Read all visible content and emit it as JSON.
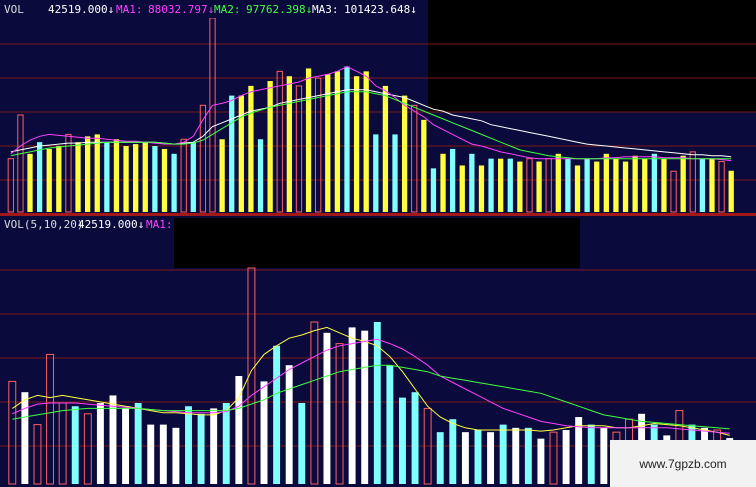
{
  "top_header": {
    "vol_label": "VOL",
    "vol_value": "42519.000↓",
    "ma1_label": "MA1:",
    "ma1_value": "88032.797↓",
    "ma2_label": "MA2:",
    "ma2_value": "97762.398↓",
    "ma3_label": "MA3:",
    "ma3_value": "101423.648↓"
  },
  "bottom_header": {
    "label": "VOL(5,10,20)",
    "value": "42519.000↓",
    "ma1_label": "MA1:"
  },
  "watermark": "www.7gpzb.com",
  "colors": {
    "panel_bg": "#0a0a3c",
    "grid": "#7a1a1a",
    "ma1": "#ffffff",
    "ma2": "#ff40ff",
    "ma3": "#40ff40",
    "ma5_bottom": "#ffff40",
    "ma10_bottom": "#ff40ff",
    "ma20_bottom": "#40ff40",
    "bar_yellow": "#ffff40",
    "bar_cyan": "#80ffff",
    "bar_hollow": "#ff6060",
    "bar_white": "#ffffff"
  },
  "chart_data": [
    {
      "type": "bar",
      "panel": "top",
      "ylim": [
        0,
        200000
      ],
      "bars": [
        {
          "v": 55000,
          "s": "hollow"
        },
        {
          "v": 100000,
          "s": "hollow"
        },
        {
          "v": 60000,
          "s": "yellow"
        },
        {
          "v": 72000,
          "s": "cyan"
        },
        {
          "v": 65000,
          "s": "yellow"
        },
        {
          "v": 68000,
          "s": "yellow"
        },
        {
          "v": 80000,
          "s": "hollow"
        },
        {
          "v": 72000,
          "s": "yellow"
        },
        {
          "v": 78000,
          "s": "yellow"
        },
        {
          "v": 80000,
          "s": "yellow"
        },
        {
          "v": 72000,
          "s": "cyan"
        },
        {
          "v": 75000,
          "s": "yellow"
        },
        {
          "v": 68000,
          "s": "yellow"
        },
        {
          "v": 70000,
          "s": "yellow"
        },
        {
          "v": 72000,
          "s": "yellow"
        },
        {
          "v": 68000,
          "s": "cyan"
        },
        {
          "v": 65000,
          "s": "yellow"
        },
        {
          "v": 60000,
          "s": "cyan"
        },
        {
          "v": 75000,
          "s": "hollow"
        },
        {
          "v": 72000,
          "s": "cyan"
        },
        {
          "v": 110000,
          "s": "hollow"
        },
        {
          "v": 200000,
          "s": "hollow"
        },
        {
          "v": 75000,
          "s": "yellow"
        },
        {
          "v": 120000,
          "s": "cyan"
        },
        {
          "v": 120000,
          "s": "yellow"
        },
        {
          "v": 130000,
          "s": "yellow"
        },
        {
          "v": 75000,
          "s": "cyan"
        },
        {
          "v": 135000,
          "s": "yellow"
        },
        {
          "v": 145000,
          "s": "hollow"
        },
        {
          "v": 140000,
          "s": "yellow"
        },
        {
          "v": 130000,
          "s": "hollow"
        },
        {
          "v": 148000,
          "s": "yellow"
        },
        {
          "v": 138000,
          "s": "hollow"
        },
        {
          "v": 142000,
          "s": "yellow"
        },
        {
          "v": 145000,
          "s": "yellow"
        },
        {
          "v": 150000,
          "s": "cyan"
        },
        {
          "v": 140000,
          "s": "yellow"
        },
        {
          "v": 145000,
          "s": "yellow"
        },
        {
          "v": 80000,
          "s": "cyan"
        },
        {
          "v": 130000,
          "s": "yellow"
        },
        {
          "v": 80000,
          "s": "cyan"
        },
        {
          "v": 120000,
          "s": "yellow"
        },
        {
          "v": 110000,
          "s": "hollow"
        },
        {
          "v": 95000,
          "s": "yellow"
        },
        {
          "v": 45000,
          "s": "cyan"
        },
        {
          "v": 60000,
          "s": "yellow"
        },
        {
          "v": 65000,
          "s": "cyan"
        },
        {
          "v": 48000,
          "s": "yellow"
        },
        {
          "v": 60000,
          "s": "cyan"
        },
        {
          "v": 48000,
          "s": "yellow"
        },
        {
          "v": 55000,
          "s": "cyan"
        },
        {
          "v": 55000,
          "s": "yellow"
        },
        {
          "v": 55000,
          "s": "cyan"
        },
        {
          "v": 52000,
          "s": "yellow"
        },
        {
          "v": 55000,
          "s": "hollow"
        },
        {
          "v": 52000,
          "s": "yellow"
        },
        {
          "v": 55000,
          "s": "hollow"
        },
        {
          "v": 60000,
          "s": "yellow"
        },
        {
          "v": 55000,
          "s": "cyan"
        },
        {
          "v": 48000,
          "s": "yellow"
        },
        {
          "v": 55000,
          "s": "cyan"
        },
        {
          "v": 52000,
          "s": "yellow"
        },
        {
          "v": 60000,
          "s": "yellow"
        },
        {
          "v": 55000,
          "s": "yellow"
        },
        {
          "v": 52000,
          "s": "yellow"
        },
        {
          "v": 58000,
          "s": "yellow"
        },
        {
          "v": 55000,
          "s": "yellow"
        },
        {
          "v": 60000,
          "s": "cyan"
        },
        {
          "v": 55000,
          "s": "yellow"
        },
        {
          "v": 42000,
          "s": "hollow"
        },
        {
          "v": 58000,
          "s": "yellow"
        },
        {
          "v": 62000,
          "s": "hollow"
        },
        {
          "v": 55000,
          "s": "cyan"
        },
        {
          "v": 55000,
          "s": "yellow"
        },
        {
          "v": 52000,
          "s": "hollow"
        },
        {
          "v": 42519,
          "s": "yellow"
        }
      ],
      "series": [
        {
          "key": "ma1",
          "color": "#ffffff",
          "values": [
            62000,
            64000,
            66000,
            68000,
            69000,
            70000,
            71000,
            71000,
            72000,
            72000,
            72000,
            72000,
            72000,
            72000,
            72000,
            72000,
            71000,
            70000,
            71000,
            72000,
            78000,
            88000,
            92000,
            96000,
            100000,
            104000,
            106000,
            108000,
            112000,
            114000,
            116000,
            118000,
            120000,
            122000,
            124000,
            126000,
            126000,
            126000,
            124000,
            122000,
            120000,
            118000,
            114000,
            110000,
            106000,
            104000,
            100000,
            98000,
            96000,
            94000,
            90000,
            88000,
            86000,
            84000,
            82000,
            80000,
            78000,
            76000,
            74000,
            72000,
            70000,
            69000,
            68000,
            67000,
            66000,
            65000,
            64000,
            63000,
            62000,
            61000,
            60000,
            59000,
            59000,
            58000,
            58000,
            57000
          ]
        },
        {
          "key": "ma2",
          "color": "#ff40ff",
          "values": [
            60000,
            68000,
            74000,
            78000,
            80000,
            79000,
            78000,
            77000,
            76000,
            76000,
            75000,
            74000,
            73000,
            73000,
            72000,
            71000,
            70000,
            70000,
            72000,
            78000,
            95000,
            110000,
            112000,
            115000,
            120000,
            124000,
            126000,
            128000,
            130000,
            132000,
            134000,
            138000,
            140000,
            142000,
            145000,
            150000,
            145000,
            140000,
            130000,
            125000,
            118000,
            110000,
            104000,
            98000,
            90000,
            85000,
            80000,
            75000,
            70000,
            68000,
            65000,
            62000,
            60000,
            58000,
            56000,
            55000,
            55000,
            55000,
            55000,
            55000,
            55000,
            55000,
            56000,
            56000,
            57000,
            57000,
            57000,
            57000,
            56000,
            56000,
            56000,
            55000,
            55000,
            55000,
            54000,
            53000
          ]
        },
        {
          "key": "ma3",
          "color": "#40ff40",
          "values": [
            58000,
            60000,
            62000,
            64000,
            66000,
            67000,
            68000,
            69000,
            70000,
            71000,
            72000,
            72000,
            72000,
            72000,
            72000,
            72000,
            71000,
            70000,
            70000,
            71000,
            74000,
            80000,
            86000,
            92000,
            98000,
            102000,
            105000,
            108000,
            110000,
            112000,
            114000,
            116000,
            118000,
            120000,
            122000,
            124000,
            124000,
            124000,
            122000,
            120000,
            116000,
            112000,
            108000,
            104000,
            100000,
            96000,
            92000,
            88000,
            84000,
            80000,
            76000,
            72000,
            68000,
            64000,
            62000,
            60000,
            58000,
            57000,
            56000,
            55000,
            55000,
            55000,
            55000,
            55000,
            55000,
            55000,
            55000,
            55000,
            55000,
            55000,
            55000,
            55000,
            55000,
            55000,
            55000,
            55000
          ]
        }
      ]
    },
    {
      "type": "bar",
      "panel": "bottom",
      "ylim": [
        0,
        200000
      ],
      "bars": [
        {
          "v": 95000,
          "s": "hollow"
        },
        {
          "v": 85000,
          "s": "white"
        },
        {
          "v": 55000,
          "s": "hollow"
        },
        {
          "v": 120000,
          "s": "hollow"
        },
        {
          "v": 75000,
          "s": "hollow"
        },
        {
          "v": 72000,
          "s": "cyan"
        },
        {
          "v": 65000,
          "s": "hollow"
        },
        {
          "v": 75000,
          "s": "white"
        },
        {
          "v": 82000,
          "s": "white"
        },
        {
          "v": 70000,
          "s": "white"
        },
        {
          "v": 75000,
          "s": "cyan"
        },
        {
          "v": 55000,
          "s": "white"
        },
        {
          "v": 55000,
          "s": "white"
        },
        {
          "v": 52000,
          "s": "white"
        },
        {
          "v": 72000,
          "s": "cyan"
        },
        {
          "v": 65000,
          "s": "cyan"
        },
        {
          "v": 70000,
          "s": "white"
        },
        {
          "v": 75000,
          "s": "cyan"
        },
        {
          "v": 100000,
          "s": "white"
        },
        {
          "v": 200000,
          "s": "hollow"
        },
        {
          "v": 95000,
          "s": "white"
        },
        {
          "v": 128000,
          "s": "cyan"
        },
        {
          "v": 110000,
          "s": "white"
        },
        {
          "v": 75000,
          "s": "cyan"
        },
        {
          "v": 150000,
          "s": "hollow"
        },
        {
          "v": 140000,
          "s": "white"
        },
        {
          "v": 130000,
          "s": "hollow"
        },
        {
          "v": 145000,
          "s": "white"
        },
        {
          "v": 142000,
          "s": "white"
        },
        {
          "v": 150000,
          "s": "cyan"
        },
        {
          "v": 110000,
          "s": "cyan"
        },
        {
          "v": 80000,
          "s": "cyan"
        },
        {
          "v": 85000,
          "s": "cyan"
        },
        {
          "v": 70000,
          "s": "hollow"
        },
        {
          "v": 48000,
          "s": "cyan"
        },
        {
          "v": 60000,
          "s": "cyan"
        },
        {
          "v": 48000,
          "s": "white"
        },
        {
          "v": 50000,
          "s": "cyan"
        },
        {
          "v": 48000,
          "s": "white"
        },
        {
          "v": 55000,
          "s": "cyan"
        },
        {
          "v": 52000,
          "s": "white"
        },
        {
          "v": 52000,
          "s": "cyan"
        },
        {
          "v": 42000,
          "s": "white"
        },
        {
          "v": 48000,
          "s": "hollow"
        },
        {
          "v": 50000,
          "s": "white"
        },
        {
          "v": 62000,
          "s": "white"
        },
        {
          "v": 55000,
          "s": "cyan"
        },
        {
          "v": 52000,
          "s": "white"
        },
        {
          "v": 48000,
          "s": "hollow"
        },
        {
          "v": 60000,
          "s": "hollow"
        },
        {
          "v": 65000,
          "s": "white"
        },
        {
          "v": 55000,
          "s": "cyan"
        },
        {
          "v": 45000,
          "s": "white"
        },
        {
          "v": 68000,
          "s": "hollow"
        },
        {
          "v": 55000,
          "s": "cyan"
        },
        {
          "v": 52000,
          "s": "white"
        },
        {
          "v": 50000,
          "s": "hollow"
        },
        {
          "v": 42519,
          "s": "white"
        }
      ],
      "series": [
        {
          "key": "ma5",
          "color": "#ffff40",
          "values": [
            70000,
            78000,
            82000,
            80000,
            82000,
            80000,
            78000,
            76000,
            74000,
            72000,
            70000,
            68000,
            66000,
            66000,
            65000,
            64000,
            64000,
            68000,
            80000,
            105000,
            120000,
            128000,
            135000,
            138000,
            142000,
            145000,
            140000,
            135000,
            132000,
            128000,
            118000,
            104000,
            88000,
            72000,
            62000,
            56000,
            52000,
            50000,
            50000,
            50000,
            50000,
            50000,
            49000,
            50000,
            52000,
            54000,
            54000,
            54000,
            52000,
            52000,
            54000,
            56000,
            55000,
            54000,
            52000,
            50000,
            48000,
            45000
          ]
        },
        {
          "key": "ma10",
          "color": "#ff40ff",
          "values": [
            65000,
            70000,
            74000,
            75000,
            75000,
            75000,
            74000,
            73000,
            72000,
            71000,
            70000,
            69000,
            68000,
            67000,
            66000,
            66000,
            66000,
            67000,
            72000,
            82000,
            90000,
            98000,
            106000,
            112000,
            118000,
            124000,
            128000,
            130000,
            132000,
            134000,
            130000,
            125000,
            118000,
            110000,
            100000,
            94000,
            88000,
            82000,
            76000,
            70000,
            66000,
            62000,
            58000,
            56000,
            54000,
            53000,
            52000,
            52000,
            52000,
            52000,
            52000,
            52000,
            52000,
            51000,
            50000,
            49000,
            48000,
            47000
          ]
        },
        {
          "key": "ma20",
          "color": "#40ff40",
          "values": [
            60000,
            62000,
            64000,
            66000,
            68000,
            69000,
            70000,
            70000,
            70000,
            70000,
            70000,
            69000,
            68000,
            68000,
            68000,
            68000,
            68000,
            68000,
            70000,
            74000,
            78000,
            84000,
            88000,
            92000,
            96000,
            100000,
            104000,
            106000,
            108000,
            110000,
            110000,
            108000,
            106000,
            104000,
            100000,
            98000,
            96000,
            94000,
            92000,
            90000,
            88000,
            86000,
            84000,
            80000,
            76000,
            72000,
            68000,
            64000,
            62000,
            60000,
            58000,
            57000,
            56000,
            55000,
            54000,
            53000,
            52000,
            51000
          ]
        }
      ]
    }
  ]
}
